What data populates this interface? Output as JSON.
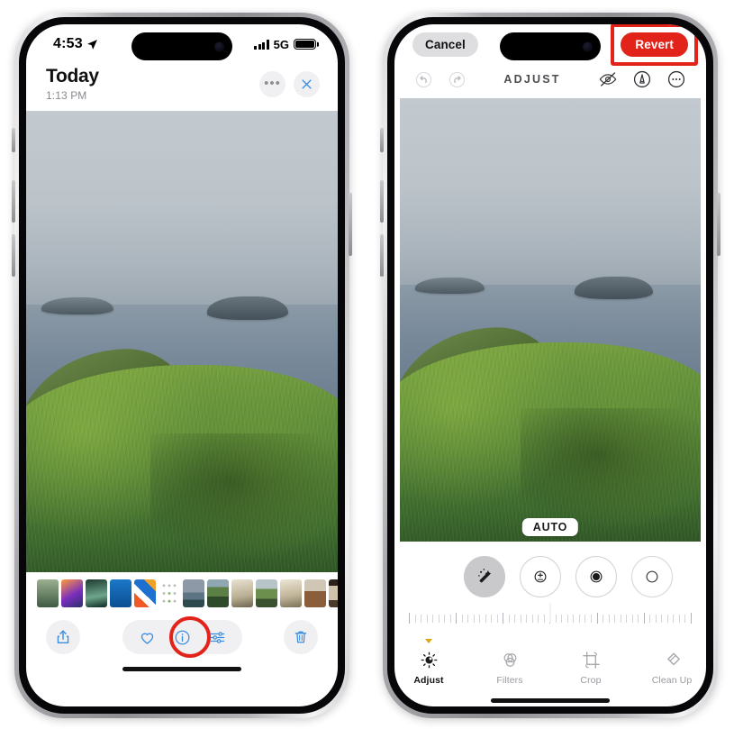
{
  "left_phone": {
    "status_bar": {
      "time": "4:53",
      "location_icon": "location-arrow-icon",
      "signal_icon": "cellular-signal-icon",
      "network": "5G",
      "battery_icon": "battery-icon"
    },
    "header": {
      "title": "Today",
      "subtitle": "1:13 PM",
      "more_icon": "more-ellipsis-icon",
      "close_icon": "close-x-icon"
    },
    "photo": {
      "alt": "coastal cliff with green grass, blue ocean and two rocky islands",
      "sky_color": "#bcc4ca",
      "sea_color": "#6a7c8e",
      "grass_color": "#62903a",
      "bay_color": "#18363c"
    },
    "filmstrip": {
      "label": "photo-filmstrip",
      "thumbnails": [
        {
          "name": "thumb-forest",
          "style": "linear-gradient(180deg,#9bb08f,#3f5a43)"
        },
        {
          "name": "thumb-sunset",
          "style": "linear-gradient(150deg,#ff9a3c,#7b2fbe 55%,#2b2f6b)"
        },
        {
          "name": "thumb-iphone",
          "style": "linear-gradient(170deg,#1d3b30,#6fa58c 60%,#0d2a22)"
        },
        {
          "name": "thumb-blue",
          "style": "linear-gradient(180deg,#1b78c8,#0d4f92)"
        },
        {
          "name": "thumb-stripes",
          "style": "linear-gradient(44deg,#f05a28 0 30%,#ffffff 30% 48%,#1d6fd0 48% 76%,#f0a12a 76% 100%)"
        },
        {
          "name": "thumb-dot-grid",
          "style": "grid"
        },
        {
          "name": "thumb-seascape",
          "style": "linear-gradient(180deg,#8d99a6 0 46%,#5d7484 46% 72%,#2f4a4f 72% 100%)"
        },
        {
          "name": "thumb-field",
          "style": "linear-gradient(180deg,#8fa7b0 0 28%,#5c7f45 28% 62%,#2f4a2a 62% 100%)"
        },
        {
          "name": "thumb-dog-a",
          "style": "linear-gradient(170deg,#e8e2d2,#b9ae92 60%,#6d6450)"
        },
        {
          "name": "thumb-meadow",
          "style": "linear-gradient(180deg,#b7c4c8 0 34%,#6d8f4e 34% 70%,#3a5230 70% 100%)"
        },
        {
          "name": "thumb-dog-b",
          "style": "linear-gradient(170deg,#ece6d6,#c0b498 58%,#7a7159)"
        },
        {
          "name": "thumb-room",
          "style": "linear-gradient(180deg,#cfc6b6 0 42%,#8a5d3b 42% 100%)"
        },
        {
          "name": "thumb-doorway",
          "style": "linear-gradient(180deg,#2a211b 0 22%,#cfc3ad 22% 74%,#4a3a2c 74% 100%)"
        },
        {
          "name": "thumb-doorway-2",
          "style": "linear-gradient(180deg,#262019 0 20%,#d6cbb6 20% 72%,#3f3226 72% 100%)"
        },
        {
          "name": "thumb-dark",
          "style": "linear-gradient(95deg,#141414 0 68%,#7d7d7d 68% 100%)"
        }
      ]
    },
    "toolbar": {
      "share_icon": "share-up-arrow-icon",
      "favorite_icon": "heart-icon",
      "info_icon": "info-circle-icon",
      "adjust_icon": "adjust-sliders-icon",
      "delete_icon": "trash-icon"
    },
    "annotation": {
      "type": "circle-highlight",
      "target": "info-circle-icon",
      "color": "#e2231a"
    }
  },
  "right_phone": {
    "header": {
      "cancel_label": "Cancel",
      "revert_label": "Revert",
      "revert_color": "#e2231a"
    },
    "edit_tools": {
      "title": "ADJUST",
      "undo_icon": "undo-arrow-icon",
      "redo_icon": "redo-arrow-icon",
      "hide_markup_icon": "eye-slash-icon",
      "markup_icon": "markup-pen-circle-icon",
      "more_icon": "more-ellipsis-circle-icon"
    },
    "photo": {
      "alt": "coastal cliff with green grass, blue ocean and two rocky islands",
      "auto_badge": "AUTO"
    },
    "adjustments": [
      {
        "name": "auto-adjust-button",
        "icon": "magic-wand-icon",
        "active": true
      },
      {
        "name": "exposure-button",
        "icon": "exposure-icon",
        "active": false
      },
      {
        "name": "brilliance-button",
        "icon": "brilliance-icon",
        "active": false
      },
      {
        "name": "highlights-button",
        "icon": "highlights-icon",
        "active": false
      }
    ],
    "slider": {
      "name": "adjust-intensity-slider",
      "tick_count": 49,
      "value_position_percent": 50
    },
    "mode_bar": [
      {
        "name": "mode-adjust",
        "label": "Adjust",
        "icon": "adjust-dial-icon",
        "active": true
      },
      {
        "name": "mode-filters",
        "label": "Filters",
        "icon": "filters-circles-icon",
        "active": false
      },
      {
        "name": "mode-crop",
        "label": "Crop",
        "icon": "crop-icon",
        "active": false
      },
      {
        "name": "mode-cleanup",
        "label": "Clean Up",
        "icon": "cleanup-eraser-icon",
        "active": false
      }
    ],
    "annotation": {
      "type": "box-highlight",
      "target": "revert-button",
      "color": "#e2231a"
    }
  }
}
